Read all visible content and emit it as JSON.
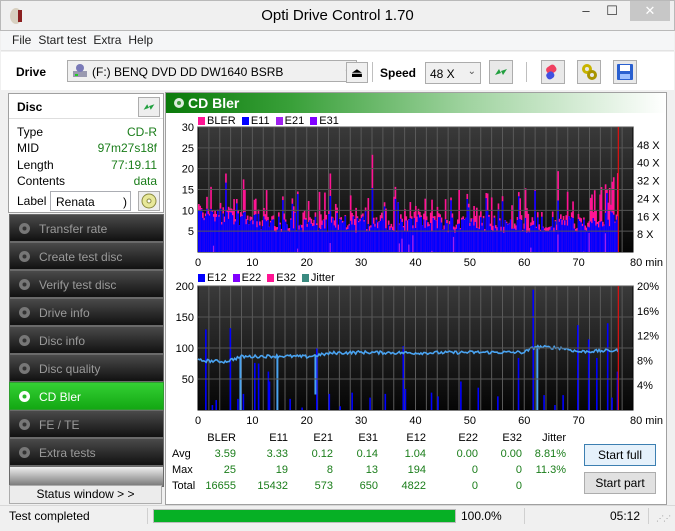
{
  "window": {
    "title": "Opti Drive Control 1.70",
    "minimize": "–",
    "maximize": "☐",
    "close": "✕"
  },
  "menu": [
    "File",
    "Start test",
    "Extra",
    "Help"
  ],
  "toolbar": {
    "drive_label": "Drive",
    "drive_value": "(F:)   BENQ DVD DD DW1640 BSRB",
    "speed_label": "Speed",
    "speed_value": "48 X",
    "chevron": "⌄",
    "eject_icon": "⏏"
  },
  "disc": {
    "heading": "Disc",
    "rows": [
      {
        "key": "Type",
        "value": "CD-R"
      },
      {
        "key": "MID",
        "value": "97m27s18f"
      },
      {
        "key": "Length",
        "value": "77:19.11"
      },
      {
        "key": "Contents",
        "value": "data"
      }
    ],
    "label_key": "Label",
    "label_value": "Renata",
    "label_arrow": ")"
  },
  "nav": [
    {
      "label": "Transfer rate",
      "active": false
    },
    {
      "label": "Create test disc",
      "active": false
    },
    {
      "label": "Verify test disc",
      "active": false
    },
    {
      "label": "Drive info",
      "active": false
    },
    {
      "label": "Disc info",
      "active": false
    },
    {
      "label": "Disc quality",
      "active": false
    },
    {
      "label": "CD Bler",
      "active": true
    },
    {
      "label": "FE / TE",
      "active": false
    },
    {
      "label": "Extra tests",
      "active": false
    }
  ],
  "status_window_button": "Status window > >",
  "panel": {
    "title": "CD Bler"
  },
  "colors": {
    "bler": "#ff1493",
    "e11": "#0000ff",
    "e21": "#a020f0",
    "e31": "#8000ff",
    "e12": "#0000ff",
    "e22": "#8000ff",
    "e32": "#ff1493",
    "jitter": "#3a8a80",
    "jitter_line": "#4aa3f0",
    "speed_line": "#e01010",
    "accent": "#06b025"
  },
  "chart_data": [
    {
      "type": "bar",
      "title": "CD Bler - upper",
      "legend": [
        "BLER",
        "E11",
        "E21",
        "E31"
      ],
      "xlabel": "min",
      "x_ticks": [
        "0",
        "10",
        "20",
        "30",
        "40",
        "50",
        "60",
        "70",
        "80 min"
      ],
      "xlim": [
        0,
        80
      ],
      "y_ticks": [
        "5",
        "10",
        "15",
        "20",
        "25",
        "30"
      ],
      "ylim": [
        0,
        30
      ],
      "y2_ticks": [
        "8 X",
        "16 X",
        "24 X",
        "32 X",
        "40 X",
        "48 X"
      ],
      "y2lim": [
        0,
        56
      ],
      "end_marker_min": 77.3,
      "series_summary": [
        {
          "name": "BLER",
          "avg": 3.59,
          "max": 25
        },
        {
          "name": "E11",
          "avg": 3.33,
          "max": 19
        },
        {
          "name": "E21",
          "avg": 0.12,
          "max": 8
        },
        {
          "name": "E31",
          "avg": 0.14,
          "max": 13
        }
      ]
    },
    {
      "type": "bar",
      "title": "CD Bler - lower",
      "legend": [
        "E12",
        "E22",
        "E32",
        "Jitter"
      ],
      "xlabel": "min",
      "x_ticks": [
        "0",
        "10",
        "20",
        "30",
        "40",
        "50",
        "60",
        "70",
        "80 min"
      ],
      "xlim": [
        0,
        80
      ],
      "y_ticks": [
        "50",
        "100",
        "150",
        "200"
      ],
      "ylim": [
        0,
        200
      ],
      "y2_ticks": [
        "4%",
        "8%",
        "12%",
        "16%",
        "20%"
      ],
      "y2lim": [
        0,
        20
      ],
      "jitter_approx_pct": [
        [
          0,
          8.0
        ],
        [
          5,
          7.8
        ],
        [
          8,
          8.6
        ],
        [
          15,
          8.7
        ],
        [
          20,
          8.6
        ],
        [
          25,
          9.2
        ],
        [
          30,
          9.3
        ],
        [
          40,
          9.2
        ],
        [
          50,
          9.3
        ],
        [
          60,
          9.3
        ],
        [
          62,
          10.2
        ],
        [
          67,
          10.0
        ],
        [
          70,
          9.4
        ],
        [
          77,
          9.6
        ]
      ],
      "end_marker_min": 77.3,
      "series_summary": [
        {
          "name": "E12",
          "avg": 1.04,
          "max": 194
        },
        {
          "name": "E22",
          "avg": 0.0,
          "max": 0
        },
        {
          "name": "E32",
          "avg": 0.0,
          "max": 0
        },
        {
          "name": "Jitter",
          "avg": "8.81%",
          "max": "11.3%"
        }
      ]
    }
  ],
  "stats": {
    "headers": [
      "BLER",
      "E11",
      "E21",
      "E31",
      "E12",
      "E22",
      "E32",
      "Jitter"
    ],
    "rows": [
      {
        "label": "Avg",
        "values": [
          "3.59",
          "3.33",
          "0.12",
          "0.14",
          "1.04",
          "0.00",
          "0.00",
          "8.81%"
        ]
      },
      {
        "label": "Max",
        "values": [
          "25",
          "19",
          "8",
          "13",
          "194",
          "0",
          "0",
          "11.3%"
        ]
      },
      {
        "label": "Total",
        "values": [
          "16655",
          "15432",
          "573",
          "650",
          "4822",
          "0",
          "0",
          ""
        ]
      }
    ]
  },
  "buttons": {
    "start_full": "Start full",
    "start_part": "Start part"
  },
  "statusbar": {
    "text": "Test completed",
    "progress": 1.0,
    "progress_text": "100.0%",
    "time": "05:12"
  }
}
